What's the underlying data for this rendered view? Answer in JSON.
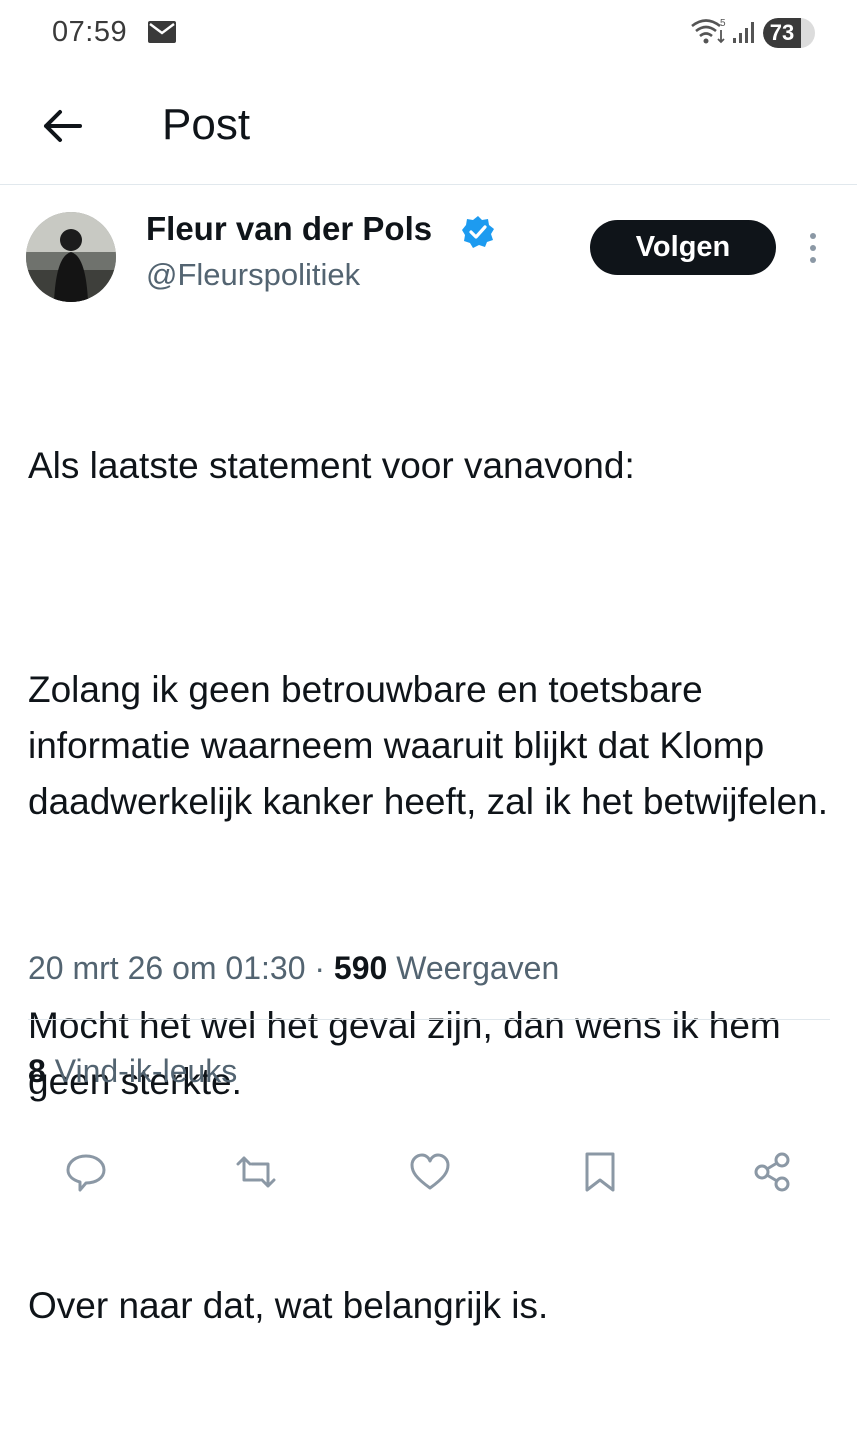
{
  "status_bar": {
    "time": "07:59",
    "icons": [
      "mail-icon",
      "wifi-icon",
      "signal-icon"
    ],
    "battery": "73",
    "battery_level_percent": 73
  },
  "header": {
    "back_icon": "back-arrow-icon",
    "title": "Post"
  },
  "post": {
    "author": {
      "name": "Fleur van der Pols",
      "handle": "@Fleurspolitiek",
      "verified": true,
      "verified_color": "#1d9bf0"
    },
    "follow_label": "Volgen",
    "paragraphs": [
      "Als laatste statement voor vanavond:",
      "Zolang ik geen betrouwbare en toetsbare informatie waarneem waaruit blijkt dat Klomp daadwerkelijk kanker heeft, zal ik het betwijfelen.",
      "Mocht het wel het geval zijn, dan wens ik hem geen sterkte.",
      "Over naar dat, wat belangrijk is."
    ],
    "timestamp": "20 mrt 26 om 01:30",
    "separator": "·",
    "views_count": "590",
    "views_label": "Weergaven",
    "likes_count": "8",
    "likes_label": "Vind-ik-leuks"
  },
  "actions": [
    "reply-icon",
    "repost-icon",
    "like-icon",
    "bookmark-icon",
    "share-icon"
  ],
  "colors": {
    "text": "#0f1419",
    "secondary": "#536471",
    "divider": "#e1e8ed",
    "follow_bg": "#0f1419"
  }
}
